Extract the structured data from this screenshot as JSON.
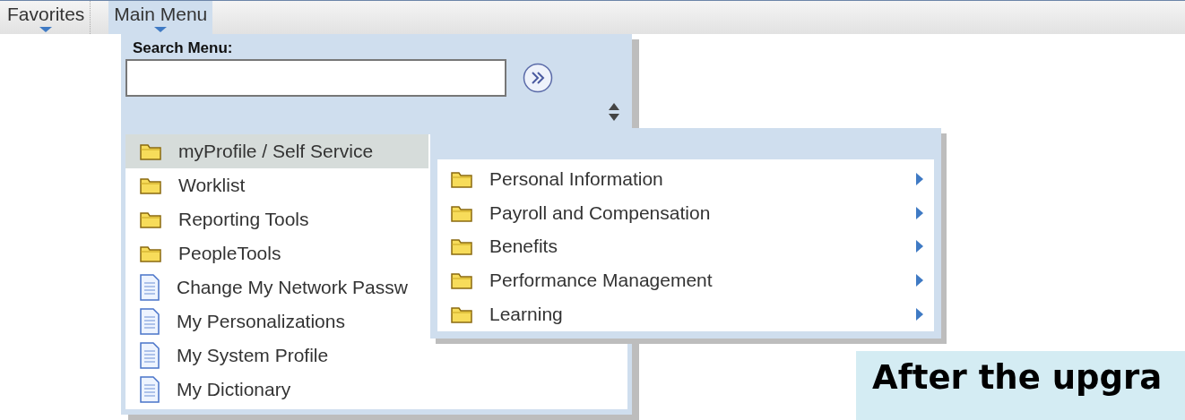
{
  "nav_tabs": [
    {
      "label": "Favorites",
      "selected": false
    },
    {
      "label": "Main Menu",
      "selected": true
    }
  ],
  "main_menu": {
    "search_label": "Search Menu:",
    "items": [
      {
        "label": "myProfile / Self Service",
        "kind": "folder",
        "selected": true
      },
      {
        "label": "Worklist",
        "kind": "folder",
        "selected": false
      },
      {
        "label": "Reporting Tools",
        "kind": "folder",
        "selected": false
      },
      {
        "label": "PeopleTools",
        "kind": "folder",
        "selected": false
      },
      {
        "label": "Change My Network Passw",
        "kind": "page",
        "selected": false
      },
      {
        "label": "My Personalizations",
        "kind": "page",
        "selected": false
      },
      {
        "label": "My System Profile",
        "kind": "page",
        "selected": false
      },
      {
        "label": "My Dictionary",
        "kind": "page",
        "selected": false
      }
    ]
  },
  "submenu": {
    "items": [
      {
        "label": "Personal Information",
        "kind": "folder"
      },
      {
        "label": "Payroll and Compensation",
        "kind": "folder"
      },
      {
        "label": "Benefits",
        "kind": "folder"
      },
      {
        "label": "Performance Management",
        "kind": "folder"
      },
      {
        "label": "Learning",
        "kind": "folder"
      }
    ]
  },
  "callout": {
    "text": "After the upgra"
  }
}
